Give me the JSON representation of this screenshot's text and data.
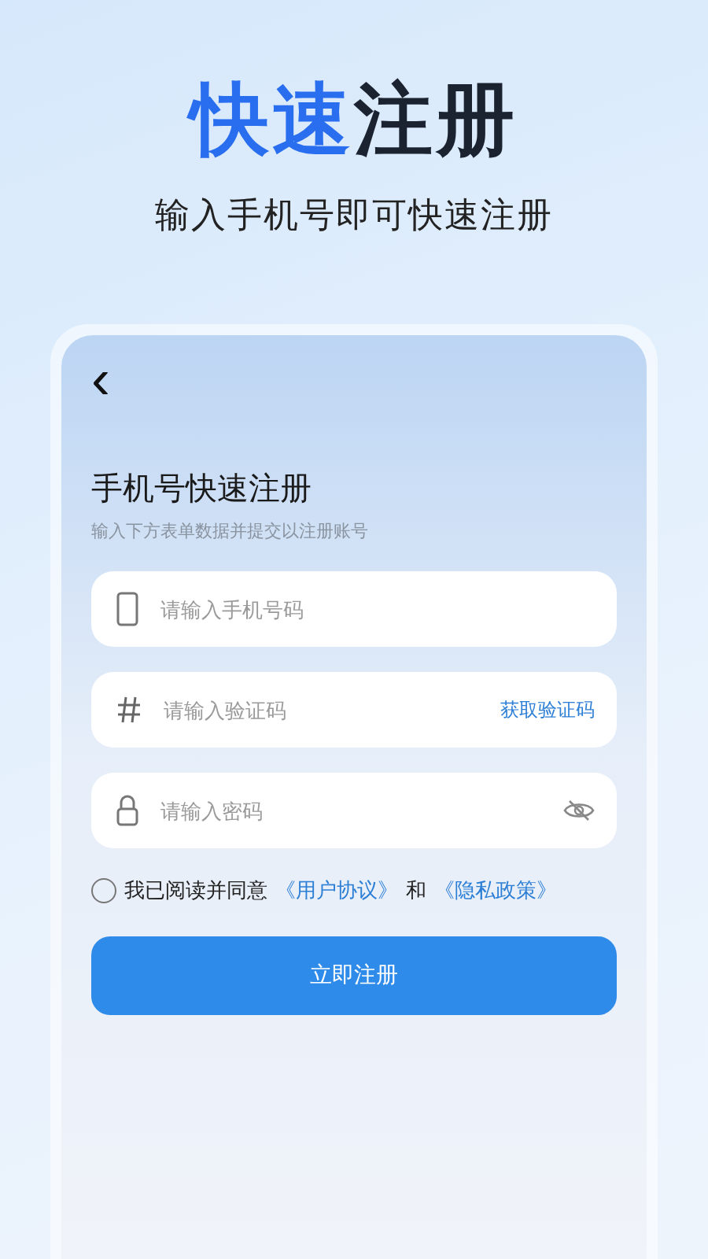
{
  "hero": {
    "headline": [
      {
        "text": "快速",
        "accent": true
      },
      {
        "text": "注册",
        "accent": false
      }
    ],
    "subtitle": "输入手机号即可快速注册"
  },
  "card": {
    "back": "‹",
    "title": "手机号快速注册",
    "subtitle": "输入下方表单数据并提交以注册账号",
    "fields": [
      {
        "kind": "phone",
        "placeholder": "请输入手机号码"
      },
      {
        "kind": "code",
        "placeholder": "请输入验证码",
        "action": "获取验证码"
      },
      {
        "kind": "password",
        "placeholder": "请输入密码"
      }
    ],
    "agreement": {
      "checked": false,
      "parts": [
        {
          "kind": "text",
          "text": "我已阅读并同意"
        },
        {
          "kind": "link",
          "text": "《用户协议》"
        },
        {
          "kind": "text",
          "text": "和"
        },
        {
          "kind": "link",
          "text": "《隐私政策》"
        }
      ]
    },
    "submit": "立即注册"
  }
}
